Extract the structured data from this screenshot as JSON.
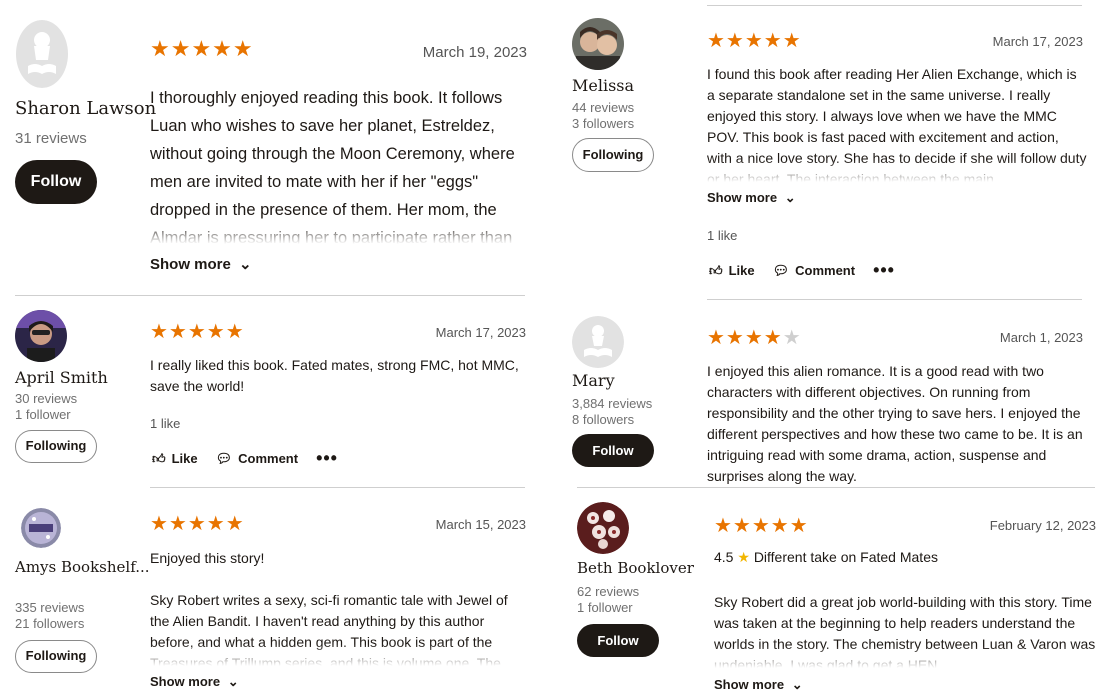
{
  "reviews": [
    {
      "reviewer": {
        "name": "Sharon Lawson",
        "reviews": "31 reviews",
        "button": "Follow",
        "avatar": "default-reader-avatar"
      },
      "rating_stars": "★★★★★",
      "rating": 5,
      "date": "March 19, 2023",
      "text": "I thoroughly enjoyed reading this book. It follows Luan who wishes to save her planet, Estreldez, without going through the Moon Ceremony, where men are invited to mate with her if her \"eggs\" dropped in the presence of them. Her mom, the Almdar is pressuring her to participate rather than watching",
      "show_more": "Show more"
    },
    {
      "reviewer": {
        "name": "Melissa",
        "reviews": "44 reviews",
        "followers": "3 followers",
        "button": "Following",
        "avatar": "couple-photo-avatar"
      },
      "rating_stars": "★★★★★",
      "rating": 5,
      "date": "March 17, 2023",
      "text": "I found this book after reading Her Alien Exchange, which is a separate standalone set in the same universe. I really enjoyed this story. I always love when we have the MMC POV. This book is fast paced with excitement and action, with a nice love story. She has to decide if she will follow duty or her heart. The interaction between the main",
      "show_more": "Show more",
      "likes": "1 like",
      "like_label": "Like",
      "comment_label": "Comment",
      "more_label": "•••"
    },
    {
      "reviewer": {
        "name": "April Smith",
        "reviews": "30 reviews",
        "followers": "1 follower",
        "button": "Following",
        "avatar": "woman-photo-avatar"
      },
      "rating_stars": "★★★★★",
      "rating": 5,
      "date": "March 17, 2023",
      "text": "I really liked this book. Fated mates, strong FMC, hot MMC, save the world!",
      "likes": "1 like",
      "like_label": "Like",
      "comment_label": "Comment",
      "more_label": "•••"
    },
    {
      "reviewer": {
        "name": "Mary",
        "reviews": "3,884 reviews",
        "followers": "8 followers",
        "button": "Follow",
        "avatar": "default-reader-avatar"
      },
      "rating_stars": "★★★★",
      "rating_off": "★",
      "rating": 4,
      "date": "March 1, 2023",
      "text": "I enjoyed this alien romance. It is a good read with two characters with different objectives. On running from responsibility and the other trying to save hers. I enjoyed the different perspectives and how these two came to be. It is an intriguing read with some drama, action, suspense and surprises along the way."
    },
    {
      "reviewer": {
        "name": "Amys Bookshelf...",
        "reviews": "335 reviews",
        "followers": "21 followers",
        "button": "Following",
        "avatar": "bookshelf-badge-avatar"
      },
      "rating_stars": "★★★★★",
      "rating": 5,
      "date": "March 15, 2023",
      "text_first": "Enjoyed this story!",
      "text": "Sky Robert writes a sexy, sci-fi romantic tale with Jewel of the Alien Bandit. I haven't read anything by this author before, and what a hidden gem. This book is part of the Treasures of Trillump series, and this is volume one. The",
      "show_more": "Show more"
    },
    {
      "reviewer": {
        "name": "Beth Booklover",
        "reviews": "62 reviews",
        "followers": "1 follower",
        "button": "Follow",
        "avatar": "flowers-photo-avatar"
      },
      "rating_stars": "★★★★★",
      "rating": 5,
      "date": "February 12, 2023",
      "score_label": "4.5",
      "heading": "Different take on Fated Mates",
      "text": "Sky Robert did a great job world-building with this story. Time was taken at the beginning to help readers understand the worlds in the story. The chemistry between Luan & Varon was undeniable. I was glad to get a HEN",
      "show_more": "Show more"
    }
  ]
}
